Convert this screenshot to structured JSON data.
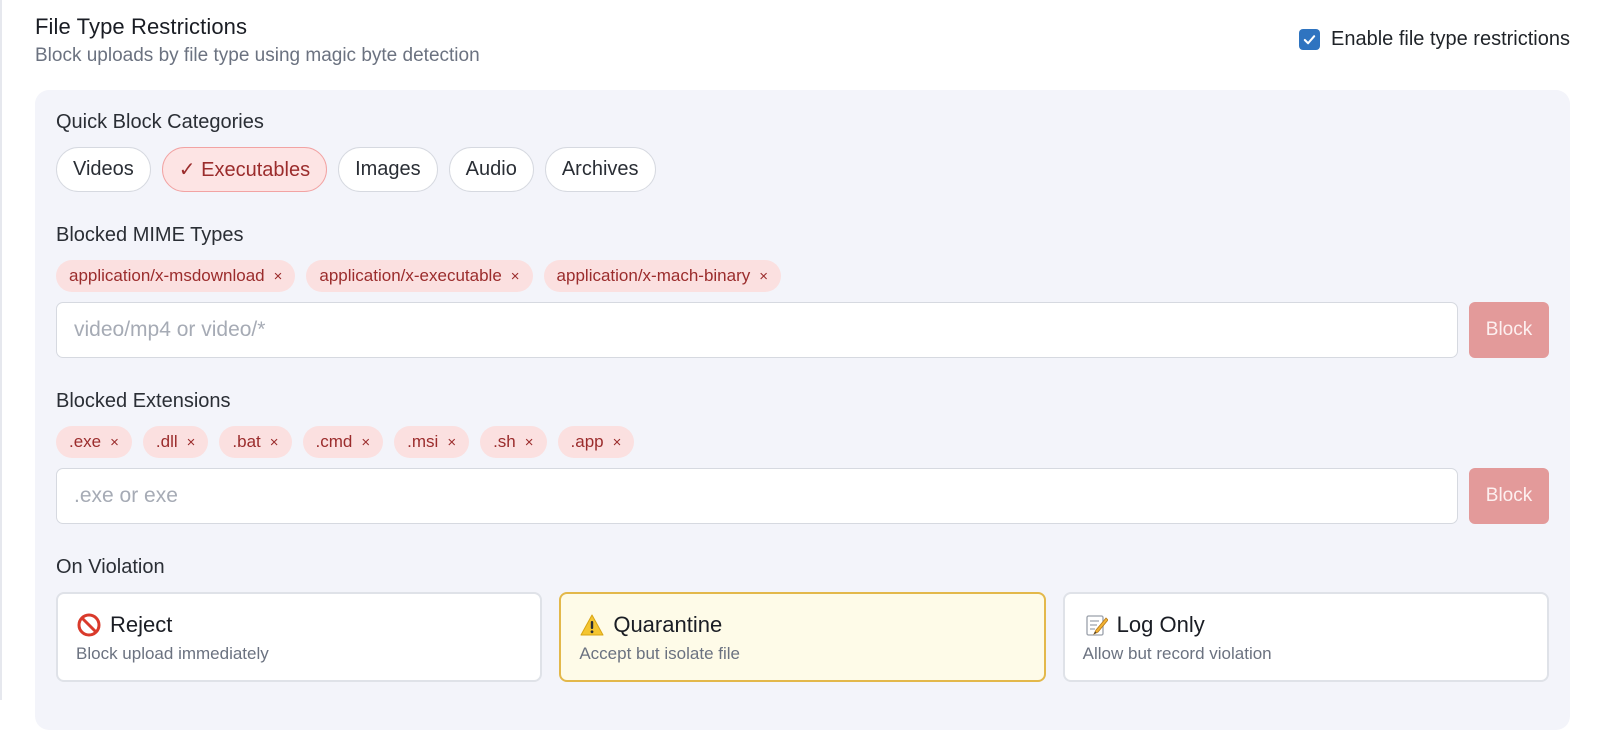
{
  "header": {
    "title": "File Type Restrictions",
    "subtitle": "Block uploads by file type using magic byte detection",
    "enable_label": "Enable file type restrictions",
    "enabled": true
  },
  "categories": {
    "label": "Quick Block Categories",
    "items": [
      {
        "label": "Videos",
        "active": false
      },
      {
        "label": "✓ Executables",
        "active": true
      },
      {
        "label": "Images",
        "active": false
      },
      {
        "label": "Audio",
        "active": false
      },
      {
        "label": "Archives",
        "active": false
      }
    ]
  },
  "mime": {
    "label": "Blocked MIME Types",
    "tags": [
      "application/x-msdownload",
      "application/x-executable",
      "application/x-mach-binary"
    ],
    "placeholder": "video/mp4 or video/*",
    "button_label": "Block"
  },
  "extensions": {
    "label": "Blocked Extensions",
    "tags": [
      ".exe",
      ".dll",
      ".bat",
      ".cmd",
      ".msi",
      ".sh",
      ".app"
    ],
    "placeholder": ".exe or exe",
    "button_label": "Block"
  },
  "remove_glyph": "×",
  "violation": {
    "label": "On Violation",
    "options": [
      {
        "icon": "no-entry-icon",
        "title": "Reject",
        "desc": "Block upload immediately",
        "selected": false
      },
      {
        "icon": "warning-icon",
        "title": "Quarantine",
        "desc": "Accept but isolate file",
        "selected": true
      },
      {
        "icon": "memo-icon",
        "title": "Log Only",
        "desc": "Allow but record violation",
        "selected": false
      }
    ]
  },
  "colors": {
    "accent_blue": "#2f74c0",
    "danger_chip_bg": "#fde4e4",
    "danger_text": "#9b2c2c",
    "block_button": "#e39a9a",
    "selected_card_border": "#e3b84a",
    "selected_card_bg": "#fefbe8"
  }
}
